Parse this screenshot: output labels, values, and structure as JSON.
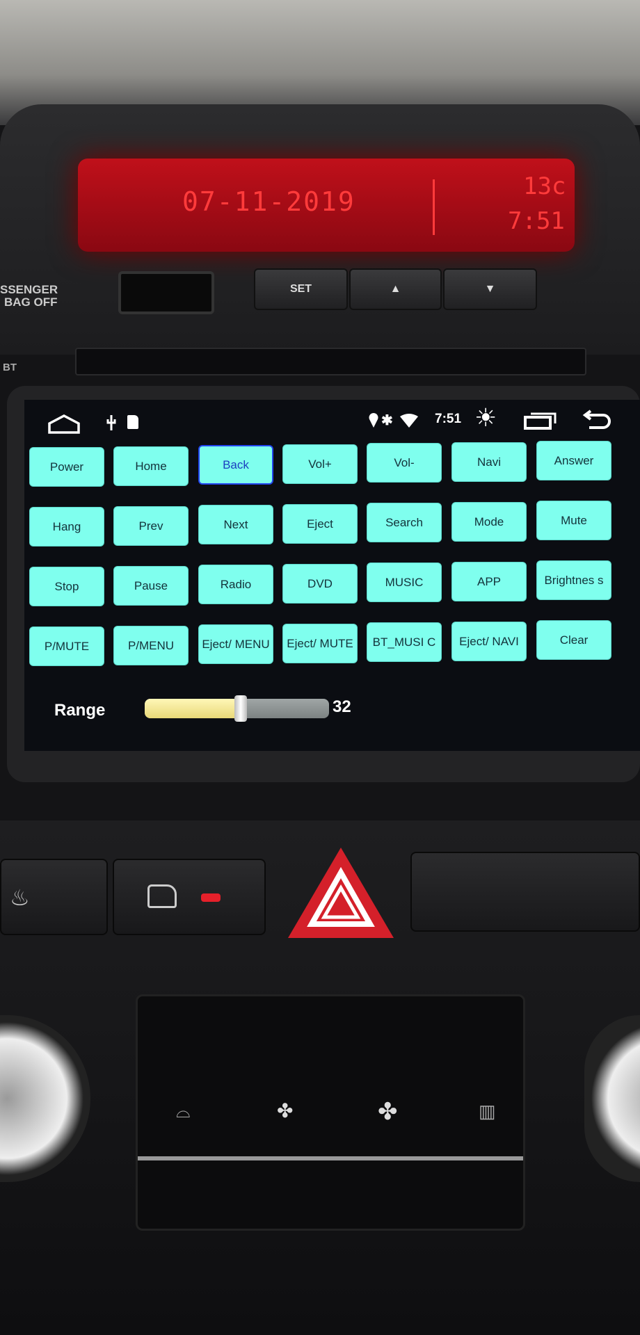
{
  "dashboard": {
    "lcd_date": "07-11-2019",
    "lcd_temp": "13c",
    "lcd_time": "7:51",
    "airbag_label_line1": "SSENGER",
    "airbag_label_line2": "BAG OFF",
    "set_label": "SET",
    "up_label": "▲",
    "down_label": "▼",
    "bt_label": "BT",
    "lcd_color": "#ff3b3b"
  },
  "status_bar": {
    "time": "7:51",
    "icons": [
      "home-icon",
      "usb-icon",
      "sd-card-icon",
      "location-icon",
      "bluetooth-icon",
      "wifi-icon",
      "brightness-icon",
      "recent-apps-icon",
      "back-icon"
    ]
  },
  "buttons": [
    [
      "Power",
      "Home",
      "Back",
      "Vol+",
      "Vol-",
      "Navi",
      "Answer"
    ],
    [
      "Hang",
      "Prev",
      "Next",
      "Eject",
      "Search",
      "Mode",
      "Mute"
    ],
    [
      "Stop",
      "Pause",
      "Radio",
      "DVD",
      "MUSIC",
      "APP",
      "Brightnes s"
    ],
    [
      "P/MUTE",
      "P/MENU",
      "Eject/ MENU",
      "Eject/ MUTE",
      "BT_MUSI C",
      "Eject/ NAVI",
      "Clear"
    ]
  ],
  "selected_button": "Back",
  "range": {
    "label": "Range",
    "value": "32",
    "fill_fraction": 0.52
  },
  "colors": {
    "button_bg": "#7fffee",
    "button_text": "#13323a",
    "selected_border": "#2244ee",
    "slider_fill": "#f3e99a"
  }
}
